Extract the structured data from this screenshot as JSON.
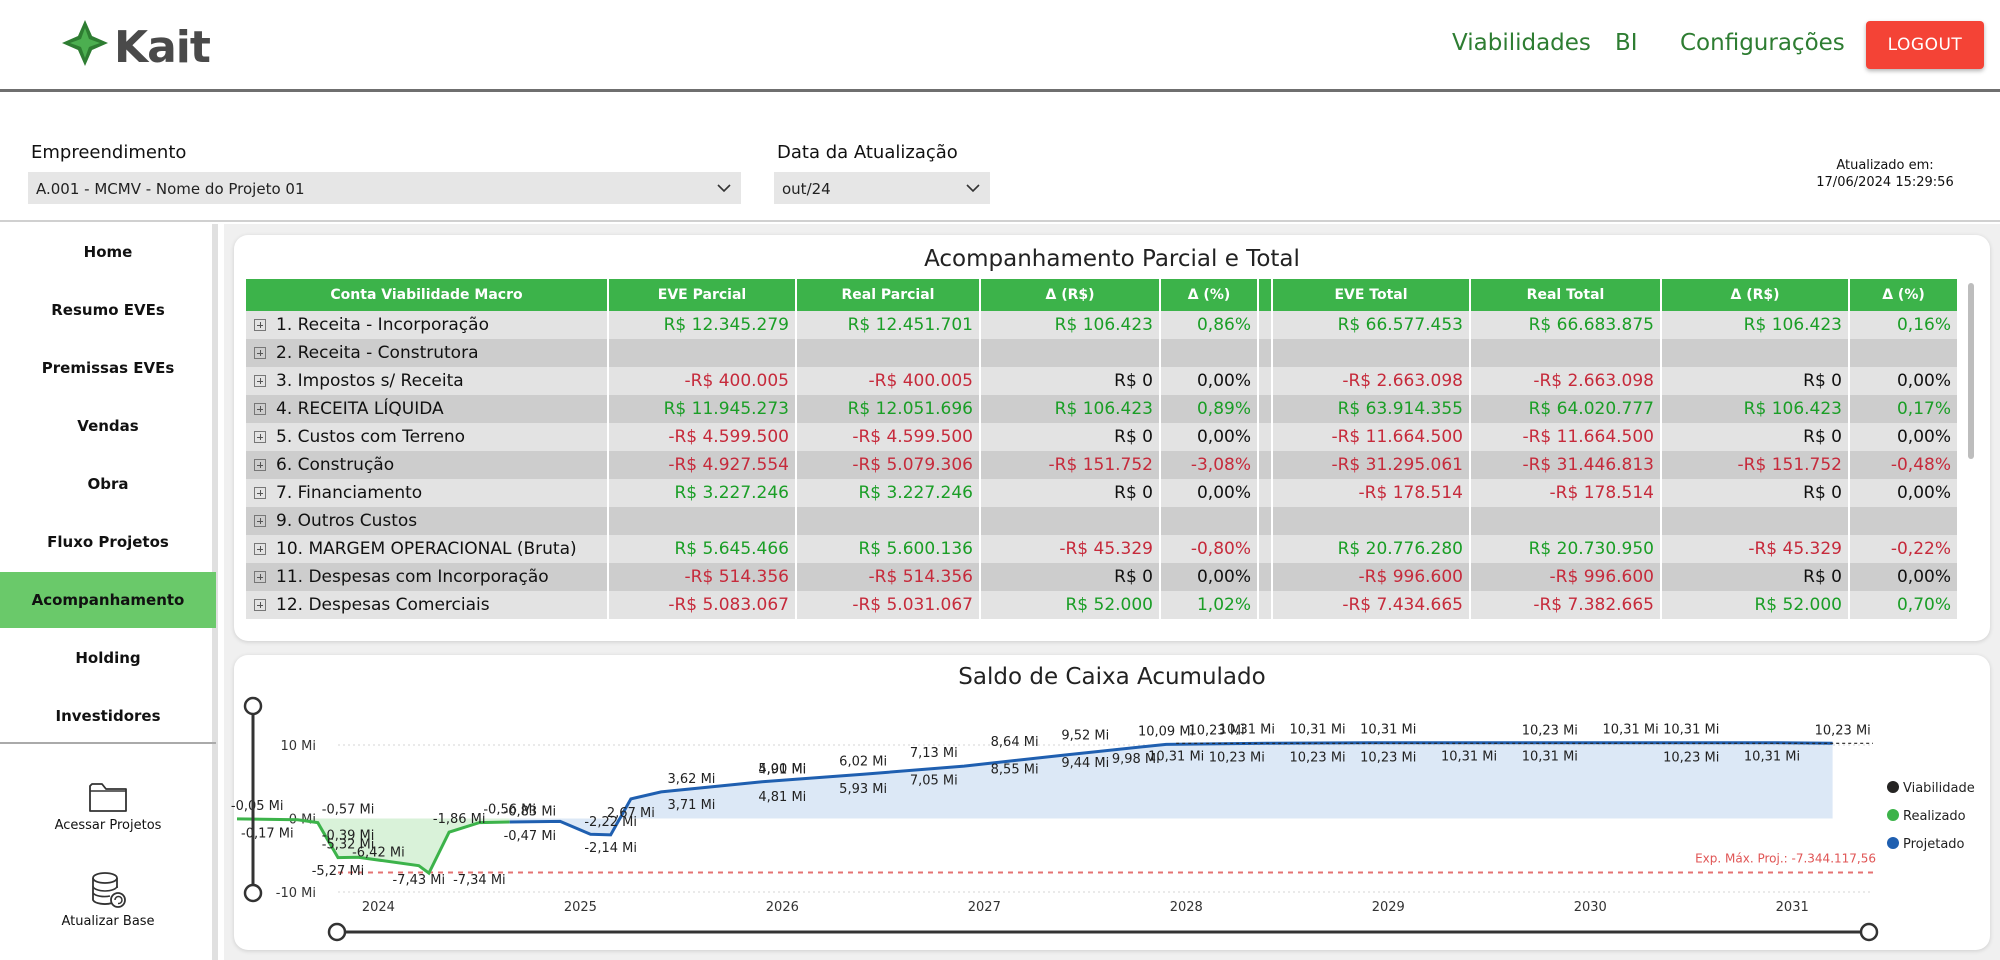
{
  "header": {
    "logo_text": "Kait",
    "nav": [
      "Viabilidades",
      "BI",
      "Configurações"
    ],
    "logout_label": "LOGOUT"
  },
  "filters": {
    "empreendimento_label": "Empreendimento",
    "empreendimento_value": "A.001 - MCMV - Nome do Projeto 01",
    "data_label": "Data da Atualização",
    "data_value": "out/24",
    "updated_label": "Atualizado em:",
    "updated_value": "17/06/2024 15:29:56"
  },
  "sidebar": {
    "items": [
      "Home",
      "Resumo EVEs",
      "Premissas EVEs",
      "Vendas",
      "Obra",
      "Fluxo Projetos",
      "Acompanhamento",
      "Holding",
      "Investidores"
    ],
    "active": "Acompanhamento",
    "actions": [
      {
        "label": "Acessar Projetos",
        "icon": "folder-icon"
      },
      {
        "label": "Atualizar Base",
        "icon": "database-refresh-icon"
      }
    ]
  },
  "table": {
    "title": "Acompanhamento Parcial e Total",
    "columns": [
      "Conta Viabilidade Macro",
      "EVE Parcial",
      "Real Parcial",
      "Δ (R$)",
      "Δ (%)",
      "",
      "EVE Total",
      "Real Total",
      "Δ (R$)",
      "Δ (%)"
    ],
    "rows": [
      [
        "1. Receita - Incorporação",
        "R$ 12.345.279",
        "R$ 12.451.701",
        "R$ 106.423",
        "0,86%",
        "",
        "R$ 66.577.453",
        "R$ 66.683.875",
        "R$ 106.423",
        "0,16%"
      ],
      [
        "2. Receita - Construtora",
        "",
        "",
        "",
        "",
        "",
        "",
        "",
        "",
        ""
      ],
      [
        "3. Impostos s/ Receita",
        "-R$ 400.005",
        "-R$ 400.005",
        "R$ 0",
        "0,00%",
        "",
        "-R$ 2.663.098",
        "-R$ 2.663.098",
        "R$ 0",
        "0,00%"
      ],
      [
        "4. RECEITA LÍQUIDA",
        "R$ 11.945.273",
        "R$ 12.051.696",
        "R$ 106.423",
        "0,89%",
        "",
        "R$ 63.914.355",
        "R$ 64.020.777",
        "R$ 106.423",
        "0,17%"
      ],
      [
        "5. Custos com Terreno",
        "-R$ 4.599.500",
        "-R$ 4.599.500",
        "R$ 0",
        "0,00%",
        "",
        "-R$ 11.664.500",
        "-R$ 11.664.500",
        "R$ 0",
        "0,00%"
      ],
      [
        "6. Construção",
        "-R$ 4.927.554",
        "-R$ 5.079.306",
        "-R$ 151.752",
        "-3,08%",
        "",
        "-R$ 31.295.061",
        "-R$ 31.446.813",
        "-R$ 151.752",
        "-0,48%"
      ],
      [
        "7. Financiamento",
        "R$ 3.227.246",
        "R$ 3.227.246",
        "R$ 0",
        "0,00%",
        "",
        "-R$ 178.514",
        "-R$ 178.514",
        "R$ 0",
        "0,00%"
      ],
      [
        "9. Outros Custos",
        "",
        "",
        "",
        "",
        "",
        "",
        "",
        "",
        ""
      ],
      [
        "10. MARGEM OPERACIONAL (Bruta)",
        "R$ 5.645.466",
        "R$ 5.600.136",
        "-R$ 45.329",
        "-0,80%",
        "",
        "R$ 20.776.280",
        "R$ 20.730.950",
        "-R$ 45.329",
        "-0,22%"
      ],
      [
        "11. Despesas com Incorporação",
        "-R$ 514.356",
        "-R$ 514.356",
        "R$ 0",
        "0,00%",
        "",
        "-R$ 996.600",
        "-R$ 996.600",
        "R$ 0",
        "0,00%"
      ],
      [
        "12. Despesas Comerciais",
        "-R$ 5.083.067",
        "-R$ 5.031.067",
        "R$ 52.000",
        "1,02%",
        "",
        "-R$ 7.434.665",
        "-R$ 7.382.665",
        "R$ 52.000",
        "0,70%"
      ]
    ],
    "colors": {
      "header": "#3cb34a",
      "positive": "#1a9e26",
      "negative": "#c62a3b"
    }
  },
  "chart_data": {
    "type": "line",
    "title": "Saldo de Caixa Acumulado",
    "xlabel": "",
    "ylabel": "",
    "x_ticks": [
      "2024",
      "2025",
      "2026",
      "2027",
      "2028",
      "2029",
      "2030",
      "2031"
    ],
    "y_ticks": [
      "10 Mi",
      "0 Mi",
      "-10 Mi"
    ],
    "ylim": [
      -10,
      10
    ],
    "legend": [
      "Viabilidade",
      "Realizado",
      "Projetado"
    ],
    "legend_position": "right",
    "colors": {
      "viabilidade": "#252423",
      "realizado": "#3cb34a",
      "projetado": "#1f5fb0",
      "fill_realizado": "#d9f2d9",
      "fill_projetado": "#dce8f6",
      "exposure_line": "#e57373"
    },
    "exposure_label": "Exp. Máx. Proj.: -7.344.117,56",
    "exposure_value": -7.344,
    "series": [
      {
        "name": "Realizado",
        "x": [
          2023.4,
          2023.7,
          2023.8,
          2023.9,
          2024.0,
          2024.3,
          2024.35,
          2024.45,
          2024.6,
          2024.75
        ],
        "values": [
          -0.05,
          -0.17,
          -0.57,
          -5.32,
          -5.27,
          -6.42,
          -7.43,
          -1.86,
          -0.56,
          -0.47
        ]
      },
      {
        "name": "Projetado",
        "x": [
          2024.75,
          2025.0,
          2025.15,
          2025.25,
          2025.35,
          2025.5,
          2026.0,
          2026.5,
          2027.0,
          2027.5,
          2028.0,
          2028.5,
          2029.0,
          2029.5,
          2030.0,
          2030.5,
          2031.0,
          2031.3
        ],
        "values": [
          -0.47,
          -0.39,
          -2.14,
          -2.22,
          2.67,
          3.62,
          5.0,
          6.02,
          7.13,
          8.64,
          10.09,
          10.23,
          10.31,
          10.31,
          10.31,
          10.31,
          10.31,
          10.23
        ]
      }
    ],
    "data_labels": [
      {
        "x": 2023.5,
        "y": -0.05,
        "text": "-0,05 Mi"
      },
      {
        "x": 2023.55,
        "y": -0.17,
        "text": "-0,17 Mi"
      },
      {
        "x": 2023.95,
        "y": -0.57,
        "text": "-0,57 Mi"
      },
      {
        "x": 2023.95,
        "y": -0.39,
        "text": "-0,39 Mi"
      },
      {
        "x": 2023.95,
        "y": -5.32,
        "text": "-5,32 Mi"
      },
      {
        "x": 2023.9,
        "y": -5.27,
        "text": "-5,27 Mi"
      },
      {
        "x": 2024.1,
        "y": -6.42,
        "text": "-6,42 Mi"
      },
      {
        "x": 2024.3,
        "y": -7.43,
        "text": "-7,43 Mi"
      },
      {
        "x": 2024.5,
        "y": -1.86,
        "text": "-1,86 Mi"
      },
      {
        "x": 2024.6,
        "y": -7.34,
        "text": "-7,34 Mi"
      },
      {
        "x": 2024.75,
        "y": -0.56,
        "text": "-0,56 Mi"
      },
      {
        "x": 2024.85,
        "y": -0.47,
        "text": "-0,47 Mi"
      },
      {
        "x": 2024.85,
        "y": -0.83,
        "text": "-0,83 Mi"
      },
      {
        "x": 2025.25,
        "y": -2.14,
        "text": "-2,14 Mi"
      },
      {
        "x": 2025.25,
        "y": -2.22,
        "text": "-2,22 Mi"
      },
      {
        "x": 2025.35,
        "y": 2.67,
        "text": "2,67 Mi"
      },
      {
        "x": 2025.65,
        "y": 3.62,
        "text": "3,62 Mi"
      },
      {
        "x": 2025.65,
        "y": 3.71,
        "text": "3,71 Mi"
      },
      {
        "x": 2026.1,
        "y": 4.91,
        "text": "4,91 Mi"
      },
      {
        "x": 2026.1,
        "y": 4.81,
        "text": "4,81 Mi"
      },
      {
        "x": 2026.1,
        "y": 5.0,
        "text": "5,00 Mi"
      },
      {
        "x": 2026.5,
        "y": 5.93,
        "text": "5,93 Mi"
      },
      {
        "x": 2026.5,
        "y": 6.02,
        "text": "6,02 Mi"
      },
      {
        "x": 2026.85,
        "y": 7.05,
        "text": "7,05 Mi"
      },
      {
        "x": 2026.85,
        "y": 7.13,
        "text": "7,13 Mi"
      },
      {
        "x": 2027.25,
        "y": 8.55,
        "text": "8,55 Mi"
      },
      {
        "x": 2027.25,
        "y": 8.64,
        "text": "8,64 Mi"
      },
      {
        "x": 2027.6,
        "y": 9.44,
        "text": "9,44 Mi"
      },
      {
        "x": 2027.6,
        "y": 9.52,
        "text": "9,52 Mi"
      },
      {
        "x": 2027.85,
        "y": 9.98,
        "text": "9,98 Mi"
      },
      {
        "x": 2028.0,
        "y": 10.09,
        "text": "10,09 Mi"
      },
      {
        "x": 2028.05,
        "y": 10.31,
        "text": "10,31 Mi"
      },
      {
        "x": 2028.25,
        "y": 10.23,
        "text": "10,23 Mi"
      },
      {
        "x": 2028.35,
        "y": 10.23,
        "text": "10,23 Mi"
      },
      {
        "x": 2028.4,
        "y": 10.31,
        "text": "10,31 Mi"
      },
      {
        "x": 2028.75,
        "y": 10.23,
        "text": "10,23 Mi"
      },
      {
        "x": 2028.75,
        "y": 10.31,
        "text": "10,31 Mi"
      },
      {
        "x": 2029.1,
        "y": 10.23,
        "text": "10,23 Mi"
      },
      {
        "x": 2029.1,
        "y": 10.31,
        "text": "10,31 Mi"
      },
      {
        "x": 2029.5,
        "y": 10.31,
        "text": "10,31 Mi"
      },
      {
        "x": 2029.9,
        "y": 10.23,
        "text": "10,23 Mi"
      },
      {
        "x": 2029.9,
        "y": 10.31,
        "text": "10,31 Mi"
      },
      {
        "x": 2030.3,
        "y": 10.31,
        "text": "10,31 Mi"
      },
      {
        "x": 2030.6,
        "y": 10.23,
        "text": "10,23 Mi"
      },
      {
        "x": 2030.6,
        "y": 10.31,
        "text": "10,31 Mi"
      },
      {
        "x": 2031.0,
        "y": 10.31,
        "text": "10,31 Mi"
      },
      {
        "x": 2031.35,
        "y": 10.23,
        "text": "10,23 Mi"
      }
    ]
  }
}
